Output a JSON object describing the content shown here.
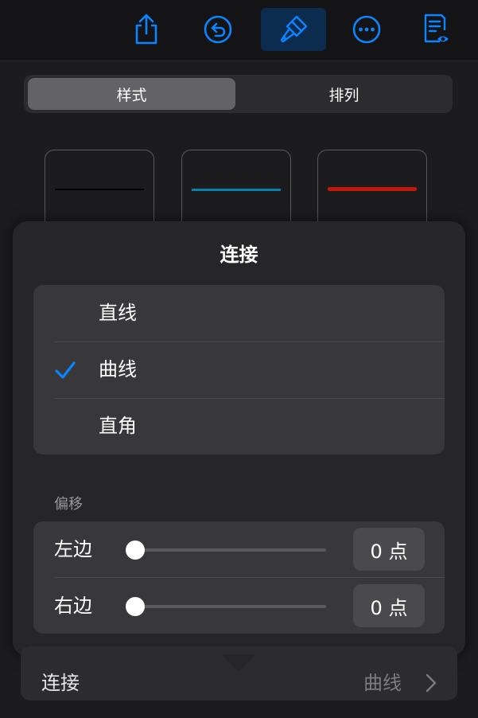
{
  "toolbar": {
    "icons": [
      "share-icon",
      "undo-icon",
      "format-brush-icon",
      "more-icon",
      "reading-view-icon"
    ],
    "accent_color": "#0a84ff"
  },
  "tabs": [
    {
      "label": "样式",
      "selected": true
    },
    {
      "label": "排列",
      "selected": false
    }
  ],
  "line_styles": [
    {
      "color": "#000000"
    },
    {
      "color": "#0a7fa8"
    },
    {
      "color": "#c0180c"
    }
  ],
  "popover": {
    "title": "连接",
    "options": [
      {
        "label": "直线",
        "checked": false
      },
      {
        "label": "曲线",
        "checked": true
      },
      {
        "label": "直角",
        "checked": false
      }
    ],
    "offset_section": "偏移",
    "sliders": [
      {
        "label": "左边",
        "value": "0 点",
        "level": 0
      },
      {
        "label": "右边",
        "value": "0 点",
        "level": 0
      }
    ]
  },
  "connection_row": {
    "label": "连接",
    "value": "曲线"
  }
}
